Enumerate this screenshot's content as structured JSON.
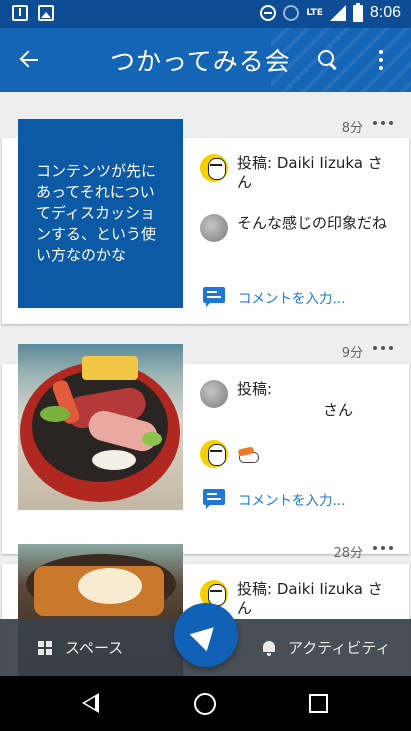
{
  "status_bar": {
    "time": "8:06",
    "network": "LTE",
    "icons": [
      "download-icon",
      "image-icon",
      "dnd-icon",
      "alarm-icon",
      "signal-icon",
      "battery-icon"
    ]
  },
  "app_bar": {
    "title": "つかってみる会",
    "back_icon": "arrow-back-icon",
    "search_icon": "search-icon",
    "more_icon": "more-vert-icon",
    "color": "#1565b6"
  },
  "posts": [
    {
      "time": "8分",
      "thumbnail_text": "コンテンツが先にあってそれについてディスカッションする、という使い方なのかな",
      "comments": [
        {
          "prefix": "投稿: ",
          "author": "Daiki Iizuka",
          "suffix": " さん"
        },
        {
          "text": "そんな感じの印象だね"
        }
      ],
      "comment_placeholder": "コメントを入力..."
    },
    {
      "time": "9分",
      "comments": [
        {
          "prefix": "投稿: ",
          "author": "",
          "suffix": "さん"
        },
        {
          "sticker": "sushi-icon"
        }
      ],
      "comment_placeholder": "コメントを入力..."
    },
    {
      "time": "28分",
      "comments": [
        {
          "prefix": "投稿: ",
          "author": "Daiki Iizuka",
          "suffix": " さん"
        }
      ]
    }
  ],
  "bottom_bar": {
    "spaces_label": "スペース",
    "activity_label": "アクティビティ",
    "fab_icon": "send-icon",
    "fab_color": "#1161b6"
  },
  "nav_bar": {
    "icons": [
      "nav-back-icon",
      "nav-home-icon",
      "nav-recents-icon"
    ]
  },
  "colors": {
    "link": "#1e78d6",
    "status_bar": "#0c4d96"
  }
}
